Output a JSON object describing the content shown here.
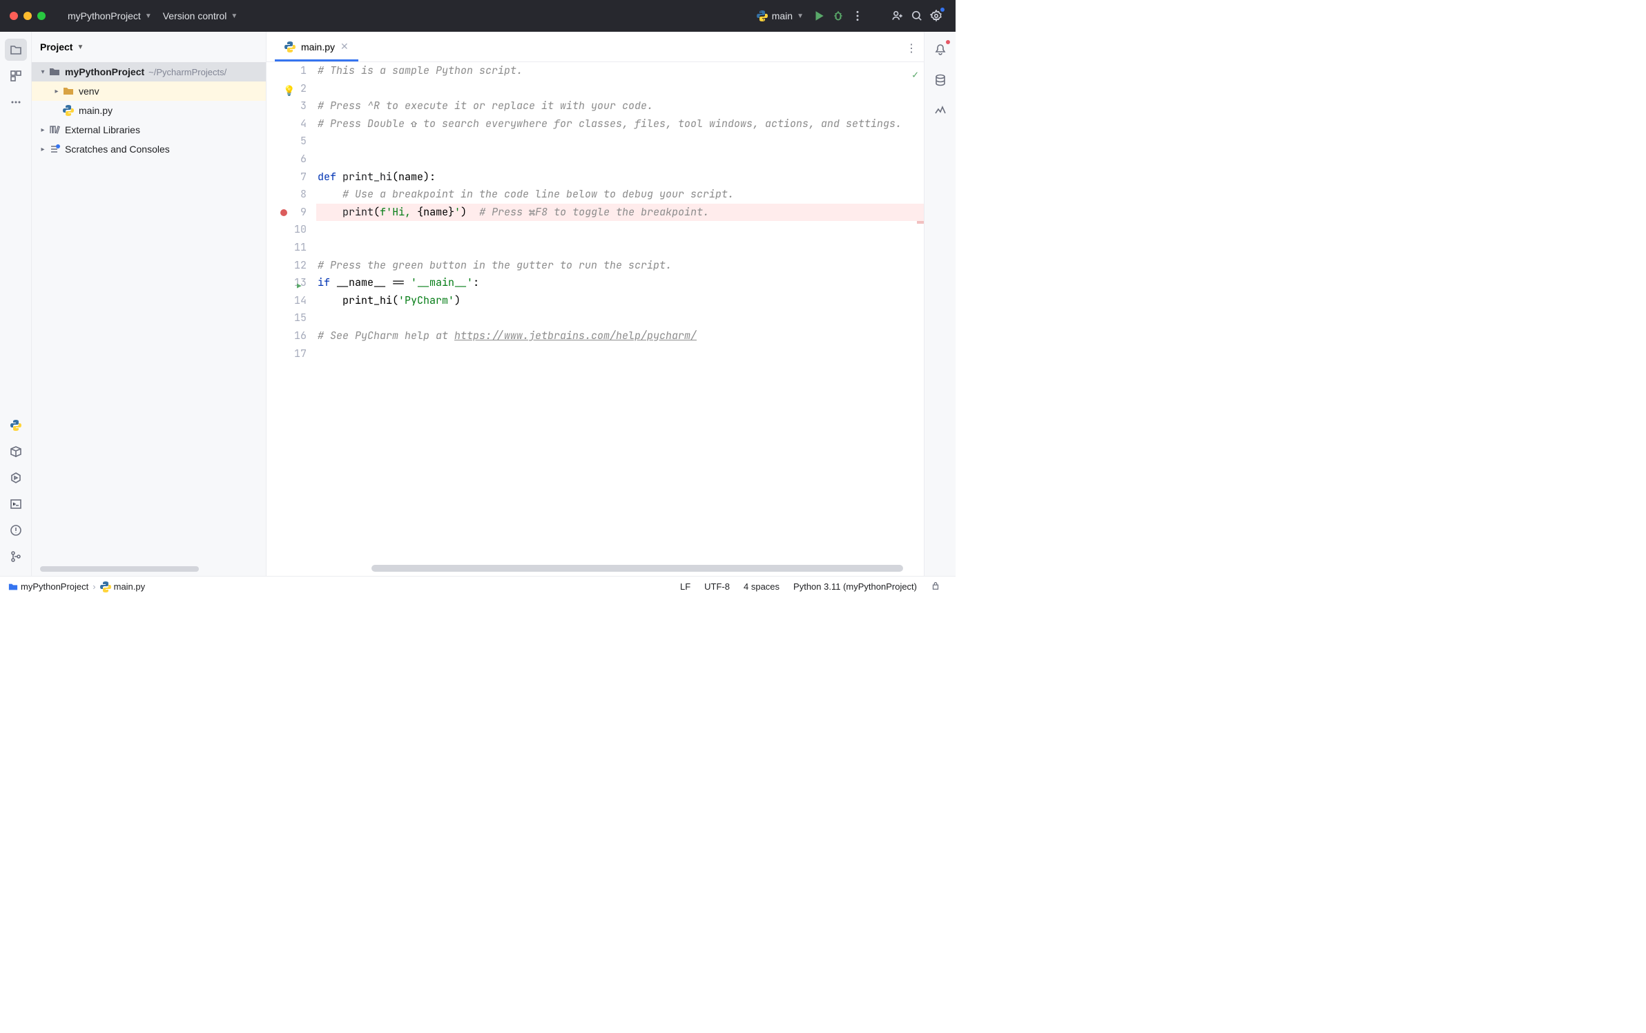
{
  "titlebar": {
    "project": "myPythonProject",
    "vcs": "Version control",
    "runconfig": "main"
  },
  "project_panel": {
    "title": "Project",
    "root": {
      "name": "myPythonProject",
      "path": "~/PycharmProjects/"
    },
    "venv": "venv",
    "mainfile": "main.py",
    "ext_libs": "External Libraries",
    "scratches": "Scratches and Consoles"
  },
  "tab": {
    "filename": "main.py"
  },
  "code": {
    "lines": [
      1,
      2,
      3,
      4,
      5,
      6,
      7,
      8,
      9,
      10,
      11,
      12,
      13,
      14,
      15,
      16,
      17
    ],
    "l1": "# This is a sample Python script.",
    "l3": "# Press ^R to execute it or replace it with your code.",
    "l4": "# Press Double ⇧ to search everywhere for classes, files, tool windows, actions, and settings.",
    "l7_def": "def ",
    "l7_name": "print_hi",
    "l7_rest": "(name):",
    "l8": "    # Use a breakpoint in the code line below to debug your script.",
    "l9_indent": "    ",
    "l9_print": "print",
    "l9_p1": "(",
    "l9_f": "f",
    "l9_s1": "'Hi, ",
    "l9_b1": "{",
    "l9_n": "name",
    "l9_b2": "}",
    "l9_s2": "'",
    "l9_p2": ")",
    "l9_c": "  # Press ⌘F8 to toggle the breakpoint.",
    "l12": "# Press the green button in the gutter to run the script.",
    "l13_if": "if ",
    "l13_name": "__name__",
    "l13_eq": " == ",
    "l13_main": "'__main__'",
    "l13_colon": ":",
    "l14_indent": "    ",
    "l14_call": "print_hi",
    "l14_p1": "(",
    "l14_arg": "'PyCharm'",
    "l14_p2": ")",
    "l16_a": "# See PyCharm help at ",
    "l16_url": "https://www.jetbrains.com/help/pycharm/"
  },
  "status": {
    "crumb1": "myPythonProject",
    "crumb2": "main.py",
    "eol": "LF",
    "enc": "UTF-8",
    "indent": "4 spaces",
    "interp": "Python 3.11 (myPythonProject)"
  }
}
